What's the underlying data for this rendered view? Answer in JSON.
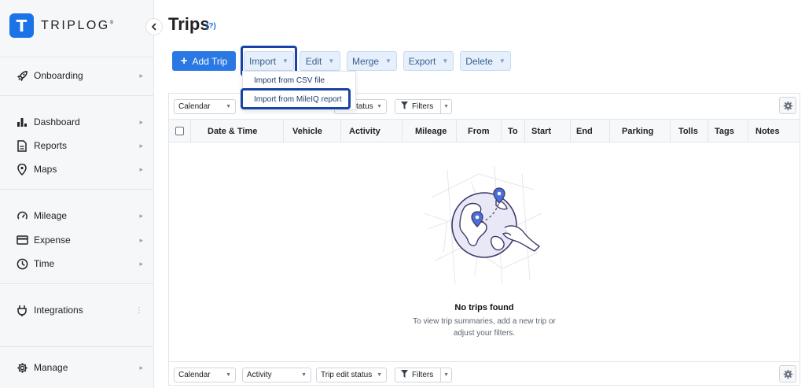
{
  "app": {
    "brand": "TRIPLOG",
    "brand_mark": "T",
    "trademark": "®"
  },
  "sidebar": {
    "items": [
      {
        "label": "Onboarding",
        "icon": "rocket-icon"
      },
      {
        "label": "Dashboard",
        "icon": "bar-chart-icon"
      },
      {
        "label": "Reports",
        "icon": "document-icon"
      },
      {
        "label": "Maps",
        "icon": "map-pin-icon"
      },
      {
        "label": "Mileage",
        "icon": "speedometer-icon"
      },
      {
        "label": "Expense",
        "icon": "credit-card-icon"
      },
      {
        "label": "Time",
        "icon": "clock-icon"
      },
      {
        "label": "Integrations",
        "icon": "plug-icon"
      },
      {
        "label": "Manage",
        "icon": "gear-icon"
      }
    ]
  },
  "page": {
    "title": "Trips",
    "help": "(?)"
  },
  "toolbar": {
    "add_trip": "Add Trip",
    "import": "Import",
    "edit": "Edit",
    "merge": "Merge",
    "export": "Export",
    "delete": "Delete"
  },
  "import_menu": {
    "items": [
      "Import from CSV file",
      "Import from MileIQ report"
    ]
  },
  "filters_top": {
    "calendar": "Calendar",
    "trip_edit_status": "status",
    "filters": "Filters"
  },
  "filters_bottom": {
    "calendar": "Calendar",
    "activity": "Activity",
    "trip_edit_status": "Trip edit status",
    "filters": "Filters"
  },
  "table": {
    "columns": [
      "Date & Time",
      "Vehicle",
      "Activity",
      "Mileage",
      "From",
      "To",
      "Start",
      "End",
      "Parking",
      "Tolls",
      "Tags",
      "Notes"
    ]
  },
  "empty_state": {
    "title": "No trips found",
    "subtitle": "To view trip summaries, add a new trip or adjust your filters."
  },
  "colors": {
    "brand": "#1b73e8",
    "primary_button": "#2a78e4",
    "highlight": "#1844a6"
  }
}
